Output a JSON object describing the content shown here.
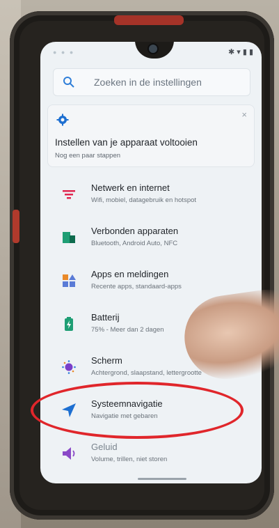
{
  "search": {
    "placeholder": "Zoeken in de instellingen"
  },
  "setup_card": {
    "title": "Instellen van je apparaat voltooien",
    "subtitle": "Nog een paar stappen",
    "close": "×"
  },
  "items": [
    {
      "title": "Netwerk en internet",
      "subtitle": "Wifi, mobiel, datagebruik en hotspot",
      "icon": "wifi-icon",
      "color": "#e0264f"
    },
    {
      "title": "Verbonden apparaten",
      "subtitle": "Bluetooth, Android Auto, NFC",
      "icon": "connected-devices-icon",
      "color": "#1e9e74"
    },
    {
      "title": "Apps en meldingen",
      "subtitle": "Recente apps, standaard-apps",
      "icon": "apps-icon",
      "color": "#e98a2a"
    },
    {
      "title": "Batterij",
      "subtitle": "75% - Meer dan 2 dagen",
      "icon": "battery-icon",
      "color": "#1e9e74"
    },
    {
      "title": "Scherm",
      "subtitle": "Achtergrond, slaapstand, lettergrootte",
      "icon": "display-icon",
      "color": "#2f7ed8"
    },
    {
      "title": "Systeemnavigatie",
      "subtitle": "Navigatie met gebaren",
      "icon": "navigation-icon",
      "color": "#1d6fd1"
    },
    {
      "title": "Geluid",
      "subtitle": "Volume, trillen, niet storen",
      "icon": "sound-icon",
      "color": "#8a49c7"
    }
  ]
}
